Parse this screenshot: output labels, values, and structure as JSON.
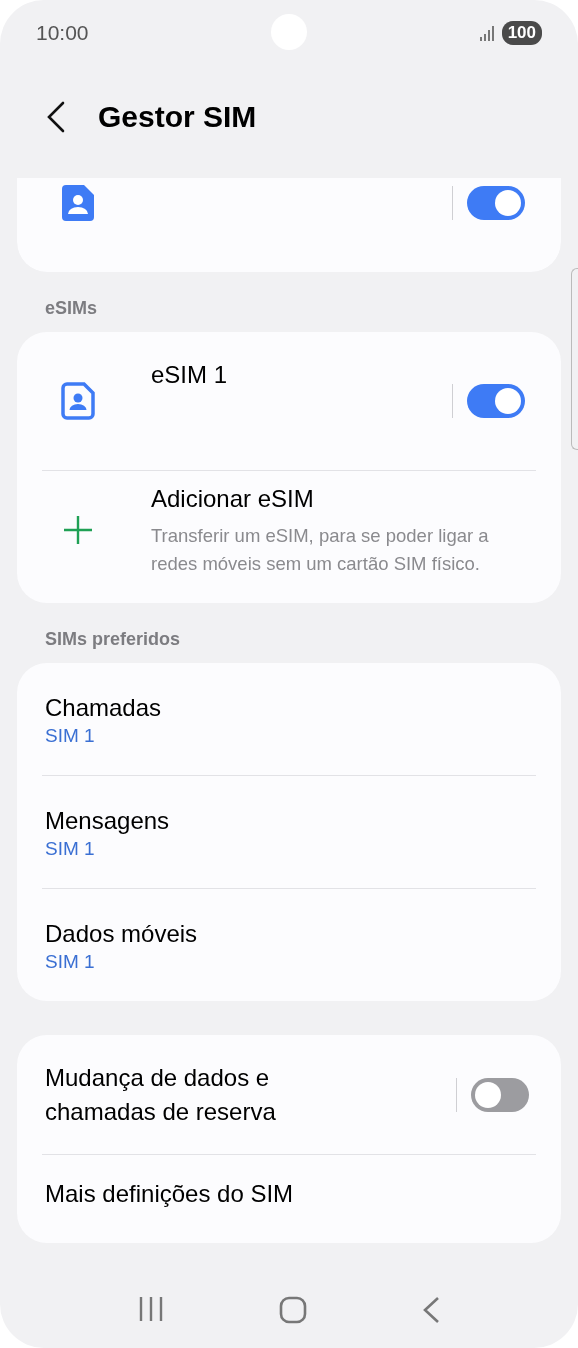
{
  "status_bar": {
    "time": "10:00",
    "battery": "100"
  },
  "header": {
    "title": "Gestor SIM"
  },
  "sim_card": {
    "on": true
  },
  "esims": {
    "title": "eSIMs",
    "items": [
      {
        "kind": "sim",
        "label": "eSIM 1",
        "on": true
      },
      {
        "kind": "add",
        "label": "Adicionar eSIM",
        "description": "Transferir um eSIM, para se poder ligar a redes móveis sem um cartão SIM físico."
      }
    ]
  },
  "preferred": {
    "title": "SIMs preferidos",
    "items": [
      {
        "label": "Chamadas",
        "value": "SIM 1"
      },
      {
        "label": "Mensagens",
        "value": "SIM 1"
      },
      {
        "label": "Dados móveis",
        "value": "SIM 1"
      }
    ]
  },
  "more": {
    "items": [
      {
        "kind": "toggle",
        "label": "Mudança de dados e chamadas de reserva",
        "on": false
      },
      {
        "kind": "link",
        "label": "Mais definições do SIM"
      }
    ]
  }
}
